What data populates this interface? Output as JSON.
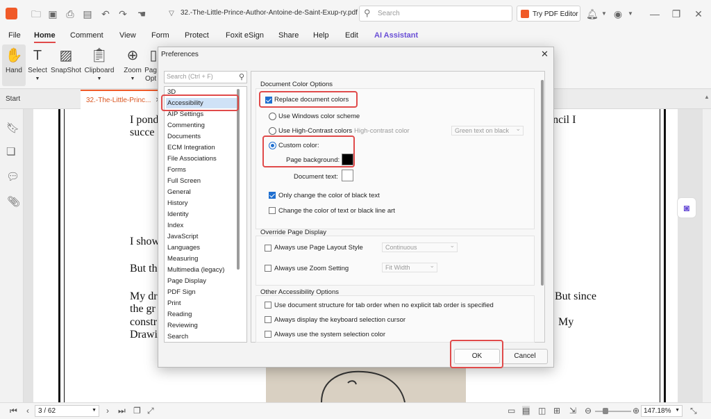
{
  "app": {
    "doc_title": "32.-The-Little-Prince-Author-Antoine-de-Saint-Exup-ry.pdf",
    "search_placeholder": "Search",
    "try_editor": "Try PDF Editor"
  },
  "menu": [
    "File",
    "Home",
    "Comment",
    "View",
    "Form",
    "Protect",
    "Foxit eSign",
    "Share",
    "Help",
    "Edit",
    "AI Assistant"
  ],
  "ribbon": {
    "hand": "Hand",
    "select": "Select",
    "snapshot": "SnapShot",
    "clipboard": "Clipboard",
    "zoom": "Zoom",
    "page_opt": "Pag\nOpt"
  },
  "tabs": {
    "start": "Start",
    "doc": "32.-The-Little-Princ..."
  },
  "page_text": {
    "l1": "I pond",
    "l1b": "encil I",
    "l2": "succe",
    "l3": "I show",
    "l4": "But th",
    "l5": "My dr",
    "l5b": "But since",
    "l6": "the gr",
    "l7": "constr",
    "l7b": "My",
    "l8": "Drawi"
  },
  "status": {
    "page": "3 / 62",
    "zoom": "147.18%"
  },
  "dialog": {
    "title": "Preferences",
    "search_placeholder": "Search (Ctrl + F)",
    "categories": [
      "3D",
      "Accessibility",
      "AIP Settings",
      "Commenting",
      "Documents",
      "ECM Integration",
      "File Associations",
      "Forms",
      "Full Screen",
      "General",
      "History",
      "Identity",
      "Index",
      "JavaScript",
      "Languages",
      "Measuring",
      "Multimedia (legacy)",
      "Page Display",
      "PDF Sign",
      "Print",
      "Reading",
      "Reviewing",
      "Search"
    ],
    "selected_category": "Accessibility",
    "color_group": {
      "title": "Document Color Options",
      "replace": "Replace document colors",
      "windows": "Use Windows color scheme",
      "high_contrast": "Use High-Contrast colors",
      "high_contrast_label": "High-contrast color",
      "high_contrast_value": "Green text on black",
      "custom": "Custom color:",
      "page_bg": "Page background:",
      "doc_text": "Document text:",
      "only_black": "Only change the color of black text",
      "line_art": "Change the color of text or black line art",
      "page_bg_color": "#000000",
      "doc_text_color": "#ffffff"
    },
    "override_group": {
      "title": "Override Page Display",
      "layout": "Always use Page Layout Style",
      "layout_value": "Continuous",
      "zoom": "Always use Zoom Setting",
      "zoom_value": "Fit Width"
    },
    "other_group": {
      "title": "Other Accessibility Options",
      "tab_order": "Use document structure for tab order when no explicit tab order is specified",
      "kb_cursor": "Always display the keyboard selection cursor",
      "sys_color": "Always use the system selection color"
    },
    "ok": "OK",
    "cancel": "Cancel"
  },
  "colors": {
    "accent": "#1f6fd0",
    "highlight": "#e04a4a",
    "selected_bg": "#cfe2f7",
    "brand": "#f05a28"
  }
}
